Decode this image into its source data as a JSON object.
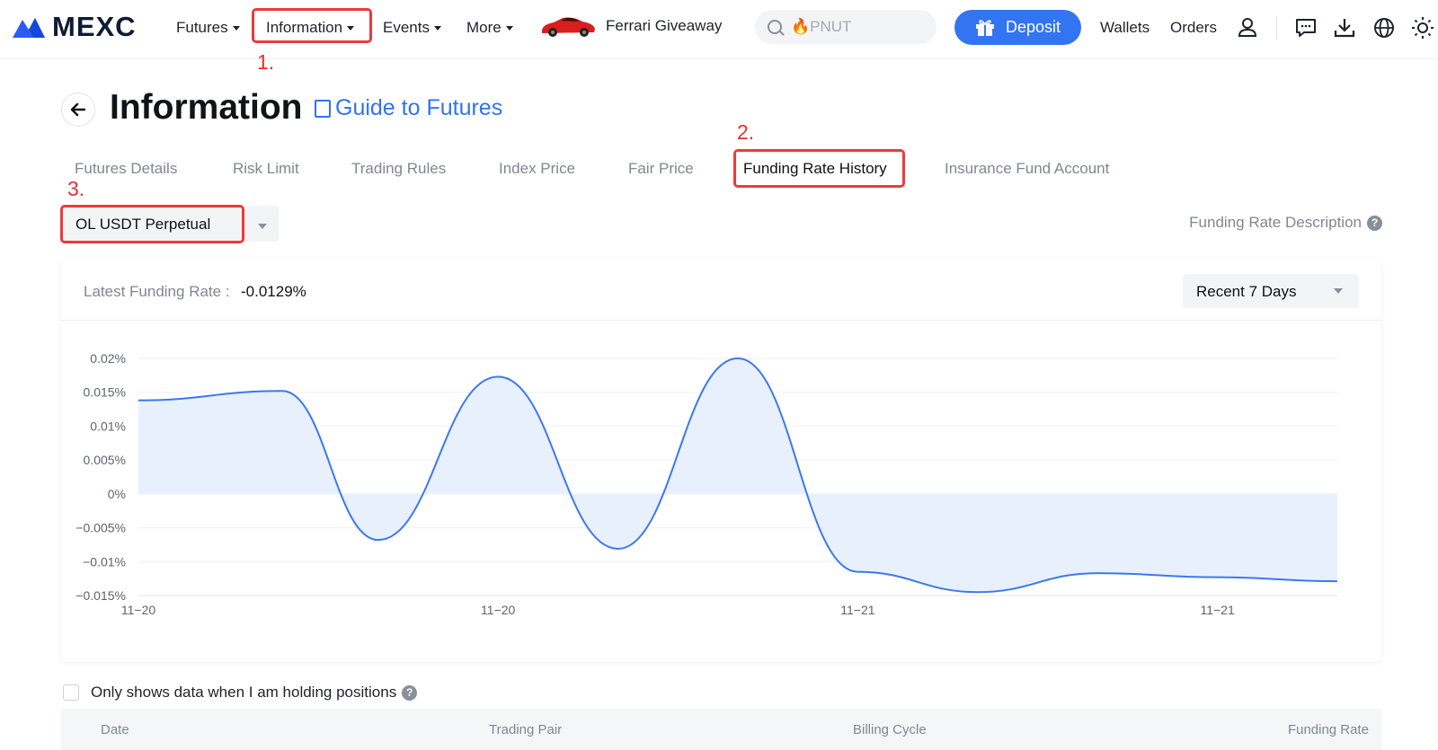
{
  "nav": {
    "logo_text": "MEXC",
    "items": [
      {
        "label": "Futures"
      },
      {
        "label": "Information"
      },
      {
        "label": "Events"
      },
      {
        "label": "More"
      }
    ],
    "promo_label": "Ferrari Giveaway",
    "search_placeholder": "🔥PNUT",
    "deposit_label": "Deposit",
    "wallets_label": "Wallets",
    "orders_label": "Orders"
  },
  "annotations": {
    "step1": "1.",
    "step2": "2.",
    "step3": "3."
  },
  "page": {
    "title": "Information",
    "guide_link": "Guide to Futures",
    "tabs": [
      {
        "label": "Futures Details"
      },
      {
        "label": "Risk Limit"
      },
      {
        "label": "Trading Rules"
      },
      {
        "label": "Index Price"
      },
      {
        "label": "Fair Price"
      },
      {
        "label": "Funding Rate History"
      },
      {
        "label": "Insurance Fund Account"
      }
    ],
    "contract_selected": "OL USDT Perpetual",
    "description_link": "Funding Rate Description",
    "help_glyph": "?"
  },
  "funding": {
    "latest_label": "Latest Funding Rate :",
    "latest_value": "-0.0129%",
    "range_selected": "Recent 7 Days"
  },
  "chart_data": {
    "type": "area",
    "title": "",
    "xlabel": "",
    "ylabel": "",
    "ylim": [
      -0.015,
      0.02
    ],
    "yticks": [
      0.02,
      0.015,
      0.01,
      0.005,
      0,
      -0.005,
      -0.01,
      -0.015
    ],
    "ytick_labels": [
      "0.02%",
      "0.015%",
      "0.01%",
      "0.005%",
      "0%",
      "−0.005%",
      "−0.01%",
      "−0.015%"
    ],
    "xtick_labels": [
      "11−20",
      "11−20",
      "11−21",
      "11−21"
    ],
    "xtick_positions": [
      0,
      3,
      6,
      9
    ],
    "grid": true,
    "series": [
      {
        "x": [
          0,
          1.2,
          2.0,
          3.0,
          4.0,
          5.0,
          6.0,
          7.0,
          8.0,
          9.0,
          10.0
        ],
        "values": [
          0.0138,
          0.0152,
          -0.0068,
          0.0173,
          -0.0081,
          0.02,
          -0.0115,
          -0.0145,
          -0.0117,
          -0.0123,
          -0.0129
        ],
        "color": "#3b78f0",
        "fill": "#e9f0fd"
      }
    ]
  },
  "table": {
    "filter_label": "Only shows data when I am holding positions",
    "columns": [
      "Date",
      "Trading Pair",
      "Billing Cycle",
      "Funding Rate"
    ]
  }
}
